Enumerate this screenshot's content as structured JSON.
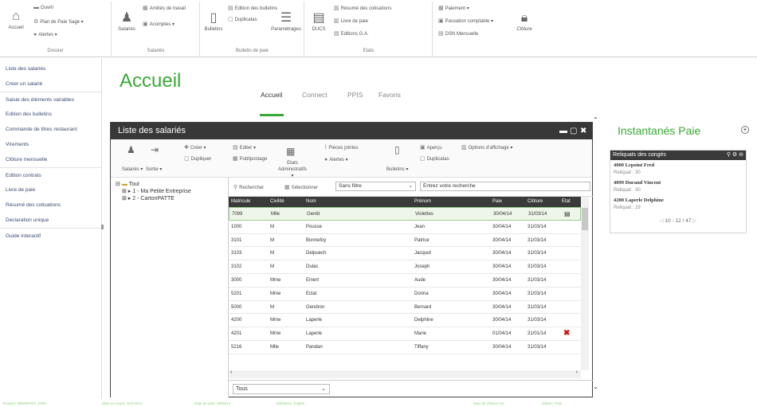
{
  "ribbon": {
    "dossier": {
      "title": "Dossier",
      "accueil": "Accueil",
      "ouvrir": "Ouvrir",
      "plan": "Plan de Paie Sage",
      "alertes": "Alertes"
    },
    "salaries": {
      "title": "Salariés",
      "salaries": "Salariés",
      "arretes": "Arrêtés de travail",
      "acomptes": "Acomptes"
    },
    "bulletin": {
      "title": "Bulletin de paie",
      "bulletins": "Bulletins",
      "edition": "Edition des bulletins",
      "duplicatas": "Duplicatas",
      "parametrages": "Paramétrages"
    },
    "etats": {
      "title": "Etats",
      "ducs": "DUCS",
      "resume": "Résumé des cotisations",
      "livre": "Livre de paie",
      "editions": "Editions G.A."
    },
    "paiement": {
      "paiement": "Paiement",
      "passation": "Passation comptable",
      "dsn": "DSN Mensuelle",
      "cloture": "Clôture"
    }
  },
  "nav": [
    "Liste des salariés",
    "Créer un salarié",
    "Saisie des éléments variables",
    "Edition des bulletins",
    "Commande de titres restaurant",
    "Virements",
    "Clôture mensuelle",
    "Edition contrats",
    "Livre de paie",
    "Résumé des cotisations",
    "Déclaration unique",
    "Guide Interactif"
  ],
  "page": {
    "title": "Accueil",
    "tabs": [
      "Accueil",
      "Connect",
      "PPIS",
      "Favoris"
    ]
  },
  "window": {
    "title": "Liste des salariés",
    "tools": {
      "salaries": "Salariés",
      "sortie": "Sortie",
      "creer": "Créer",
      "dupliquer": "Dupliquer",
      "editer": "Editer",
      "publipostage": "Publipostage",
      "etats": "Etats Administratifs",
      "pieces": "Pièces jointes",
      "alertes": "Alertes",
      "bulletins": "Bulletins",
      "apercu": "Aperçu",
      "duplicatas": "Duplicatas",
      "options": "Options d'affichage"
    },
    "tree": {
      "root": "Tout",
      "n1": "1 - Ma Petite Entreprise",
      "n2": "2 - CartonPATTE"
    },
    "search": {
      "rechercher": "Rechercher",
      "selectionner": "Sélectionner",
      "filter": "Sans filtre",
      "input": "Entrez votre recherche"
    },
    "columns": [
      "Matricule",
      "Civilité",
      "Nom",
      "Prénom",
      "Paie",
      "Clôture",
      "Etat"
    ],
    "rows": [
      [
        "7099",
        "Mlle",
        "Genêt",
        "Violettes",
        "30/04/14",
        "31/03/14"
      ],
      [
        "1000",
        "M",
        "Pousse",
        "Jean",
        "30/04/14",
        "31/03/14"
      ],
      [
        "3101",
        "M",
        "Bonnefoy",
        "Patrice",
        "30/04/14",
        "31/03/14"
      ],
      [
        "3103",
        "M",
        "Delpuech",
        "Jacquot",
        "30/04/14",
        "31/03/14"
      ],
      [
        "3102",
        "M",
        "Dulac",
        "Joseph",
        "30/04/14",
        "31/03/14"
      ],
      [
        "3000",
        "Mme",
        "Emert",
        "Aude",
        "30/04/14",
        "31/03/14"
      ],
      [
        "5201",
        "Mme",
        "Eclat",
        "Donna",
        "30/04/14",
        "31/03/14"
      ],
      [
        "5000",
        "M",
        "Gendron",
        "Bernard",
        "30/04/14",
        "31/03/14"
      ],
      [
        "4200",
        "Mme",
        "Laperle",
        "Delphine",
        "30/04/14",
        "31/03/14"
      ],
      [
        "4201",
        "Mme",
        "Laperle",
        "Marie",
        "01/04/14",
        "31/01/14"
      ],
      [
        "5216",
        "Mlle",
        "Pandan",
        "Tiffany",
        "30/04/14",
        "31/03/14"
      ]
    ],
    "footer": "Tous"
  },
  "right": {
    "title": "Instantanés Paie",
    "box": "Reliquats des congés",
    "items": [
      {
        "name": "4000 Lepoint Fred",
        "sub": "Reliquat : 30"
      },
      {
        "name": "4099 Durand Vincent",
        "sub": "Reliquat : 30"
      },
      {
        "name": "4200 Laperle Delphine",
        "sub": "Reliquat : 19"
      }
    ],
    "pager": "10 - 12 / 47"
  },
  "status": {
    "s1": "Dossier: DEMOPSPI_FRM",
    "s2": "Mois en cours: Avril 2014",
    "s3": "Date de paie: 30/04/14",
    "s4": "Utilisateur: Expert...",
    "s5": "Mois de clôture: 03",
    "s6": "Edition: Paie"
  }
}
